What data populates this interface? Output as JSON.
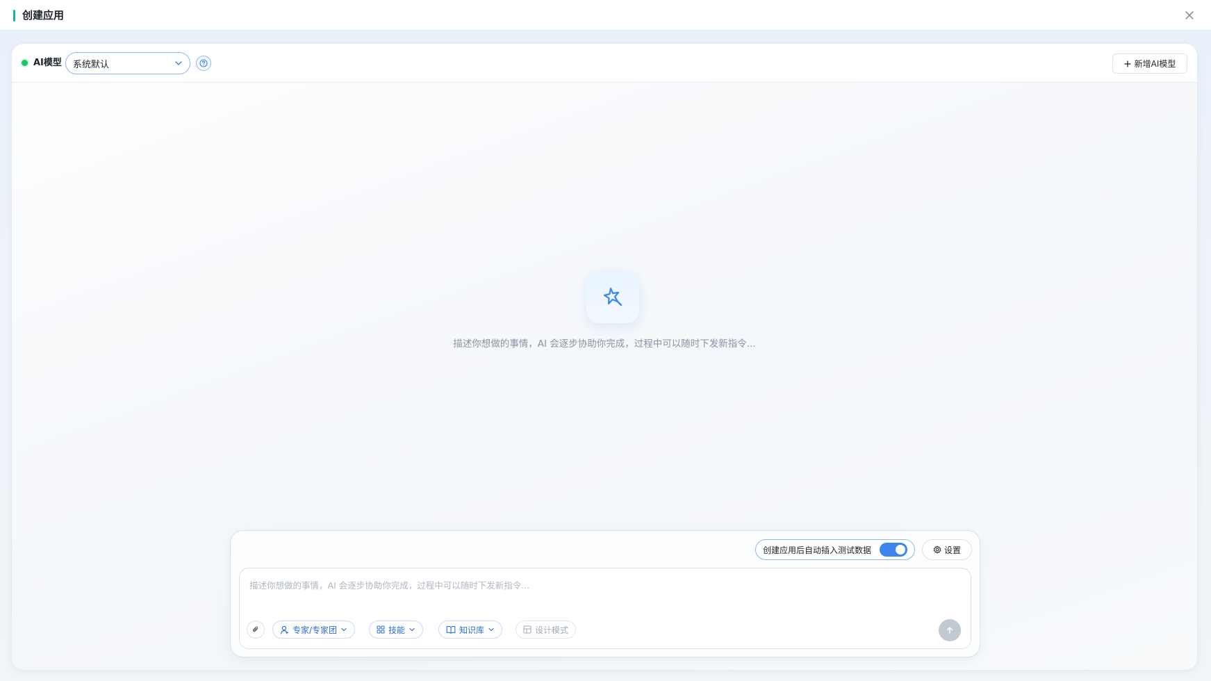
{
  "window": {
    "title": "创建应用",
    "accent_color": "#17b3a4",
    "close_icon": "close-icon"
  },
  "toolbar": {
    "status": "online",
    "status_color": "#1fc46a",
    "model_label": "AI模型",
    "model_select": {
      "value": "系统默认"
    },
    "help_icon": "help-icon",
    "add_model": {
      "icon": "plus-icon",
      "label": "新增AI模型"
    }
  },
  "empty_state": {
    "icon": "magic-wand-icon",
    "message": "描述你想做的事情，AI 会逐步协助你完成，过程中可以随时下发新指令..."
  },
  "composer": {
    "auto_insert_toggle": {
      "label": "创建应用后自动插入测试数据",
      "checked": true,
      "color": "#3c86ee"
    },
    "settings": {
      "icon": "gear-icon",
      "label": "设置"
    },
    "input": {
      "value": "",
      "placeholder": "描述你想做的事情，AI 会逐步协助你完成，过程中可以随时下发新指令..."
    },
    "attach_icon": "paperclip-icon",
    "chips": {
      "expert": {
        "icon": "user-icon",
        "label": "专家/专家团"
      },
      "skills": {
        "icon": "grid-icon",
        "label": "技能"
      },
      "knowledge": {
        "icon": "book-icon",
        "label": "知识库"
      },
      "design_mode": {
        "icon": "layout-icon",
        "label": "设计模式",
        "disabled": true
      }
    },
    "send_icon": "arrow-up-icon"
  }
}
